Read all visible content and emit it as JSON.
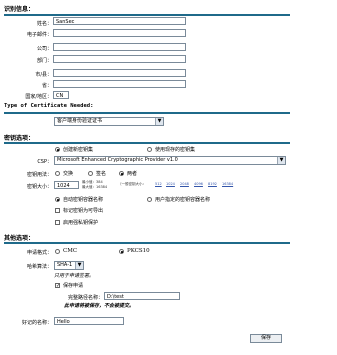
{
  "identity": {
    "title": "识别信息：",
    "fields": [
      {
        "label": "姓名：",
        "value": "SanSec"
      },
      {
        "label": "电子邮件：",
        "value": ""
      },
      {
        "label": "公司：",
        "value": ""
      },
      {
        "label": "部门：",
        "value": ""
      },
      {
        "label": "市/县：",
        "value": ""
      },
      {
        "label": "省：",
        "value": ""
      },
      {
        "label": "国家/地区：",
        "value": "CN"
      }
    ]
  },
  "cert_type": {
    "title": "Type of Certificate Needed:",
    "selected": "客户端身份验证证书"
  },
  "key_options": {
    "title": "密钥选项：",
    "create_new": "创建新密钥集",
    "use_existing": "使用现存的密钥集",
    "csp_label": "CSP：",
    "csp_value": "Microsoft Enhanced Cryptographic Provider v1.0",
    "usage_label": "密钥用法：",
    "usage_exchange": "交换",
    "usage_signature": "签名",
    "usage_both": "两者",
    "size_label": "密钥大小：",
    "size_value": "1024",
    "size_min": "最小值：384",
    "size_max": "最大值：16384",
    "size_common_label": "（一般密钥大小：",
    "size_common": [
      "512",
      "1024",
      "2048",
      "4096",
      "8192",
      "16384"
    ],
    "auto_container": "自动密钥容器名称",
    "user_container": "用户指定的密钥容器名称",
    "exportable": "标记密钥为可导出",
    "strong_protection": "启用强私钥保护"
  },
  "other": {
    "title": "其他选项：",
    "format_label": "申请格式：",
    "format_cmc": "CMC",
    "format_pkcs10": "PKCS10",
    "hash_label": "哈希算法：",
    "hash_value": "SHA-1",
    "hash_note": "只用于申请签署。",
    "save_request": "保存申请",
    "full_path_label": "完整路径名称：",
    "full_path_value": "D:\\test",
    "save_warning": "此申请将被保存，不会被提交。",
    "friendly_label": "好记的名称：",
    "friendly_value": "Hello",
    "submit_label": "保存"
  }
}
